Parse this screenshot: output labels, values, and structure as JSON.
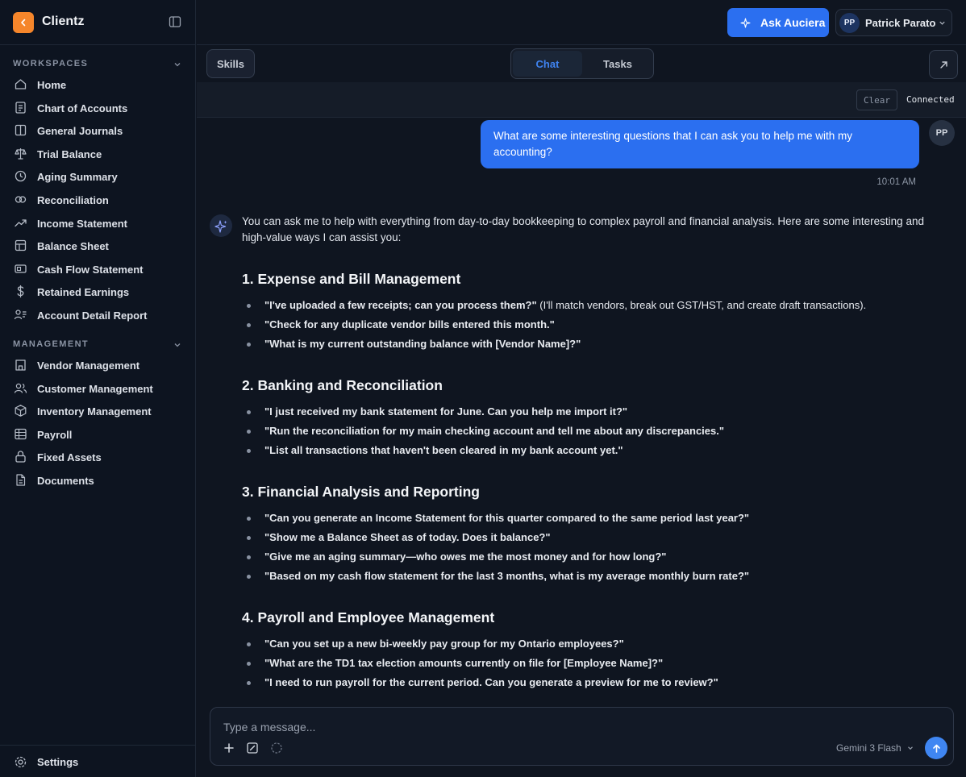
{
  "brand": {
    "name": "Clientz"
  },
  "sidebar": {
    "workspaces_label": "WORKSPACES",
    "workspaces": [
      {
        "label": "Home",
        "icon": "home-icon"
      },
      {
        "label": "Chart of Accounts",
        "icon": "document-list-icon"
      },
      {
        "label": "General Journals",
        "icon": "book-icon"
      },
      {
        "label": "Trial Balance",
        "icon": "scale-icon"
      },
      {
        "label": "Aging Summary",
        "icon": "clock-icon"
      },
      {
        "label": "Reconciliation",
        "icon": "link-circles-icon"
      },
      {
        "label": "Income Statement",
        "icon": "trend-up-icon"
      },
      {
        "label": "Balance Sheet",
        "icon": "table-icon"
      },
      {
        "label": "Cash Flow Statement",
        "icon": "banknote-icon"
      },
      {
        "label": "Retained Earnings",
        "icon": "dollar-icon"
      },
      {
        "label": "Account Detail Report",
        "icon": "user-list-icon"
      }
    ],
    "management_label": "MANAGEMENT",
    "management": [
      {
        "label": "Vendor Management",
        "icon": "store-icon"
      },
      {
        "label": "Customer Management",
        "icon": "users-icon"
      },
      {
        "label": "Inventory Management",
        "icon": "package-icon"
      },
      {
        "label": "Payroll",
        "icon": "grid-icon"
      },
      {
        "label": "Fixed Assets",
        "icon": "lock-icon"
      },
      {
        "label": "Documents",
        "icon": "file-icon"
      }
    ],
    "settings_label": "Settings"
  },
  "header": {
    "ask_label": "Ask Auciera",
    "user_initials": "PP",
    "user_name": "Patrick Parato"
  },
  "toolbar": {
    "skills_label": "Skills",
    "tabs": [
      {
        "label": "Chat"
      },
      {
        "label": "Tasks"
      }
    ],
    "clear_label": "Clear",
    "status": "Connected"
  },
  "chat": {
    "user_message": "What are some interesting questions that I can ask you to help me with my accounting?",
    "user_initials": "PP",
    "time": "10:01 AM",
    "ai_intro": "You can ask me to help with everything from day-to-day bookkeeping to complex payroll and financial analysis. Here are some interesting and high-value ways I can assist you:",
    "sections": [
      {
        "title": "1. Expense and Bill Management",
        "items": [
          {
            "q": "\"I've uploaded a few receipts; can you process them?\"",
            "note": " (I'll match vendors, break out GST/HST, and create draft transactions)."
          },
          {
            "q": "\"Check for any duplicate vendor bills entered this month.\"",
            "note": ""
          },
          {
            "q": "\"What is my current outstanding balance with [Vendor Name]?\"",
            "note": ""
          }
        ]
      },
      {
        "title": "2. Banking and Reconciliation",
        "items": [
          {
            "q": "\"I just received my bank statement for June. Can you help me import it?\"",
            "note": ""
          },
          {
            "q": "\"Run the reconciliation for my main checking account and tell me about any discrepancies.\"",
            "note": ""
          },
          {
            "q": "\"List all transactions that haven't been cleared in my bank account yet.\"",
            "note": ""
          }
        ]
      },
      {
        "title": "3. Financial Analysis and Reporting",
        "items": [
          {
            "q": "\"Can you generate an Income Statement for this quarter compared to the same period last year?\"",
            "note": ""
          },
          {
            "q": "\"Show me a Balance Sheet as of today. Does it balance?\"",
            "note": ""
          },
          {
            "q": "\"Give me an aging summary—who owes me the most money and for how long?\"",
            "note": ""
          },
          {
            "q": "\"Based on my cash flow statement for the last 3 months, what is my average monthly burn rate?\"",
            "note": ""
          }
        ]
      },
      {
        "title": "4. Payroll and Employee Management",
        "items": [
          {
            "q": "\"Can you set up a new bi-weekly pay group for my Ontario employees?\"",
            "note": ""
          },
          {
            "q": "\"What are the TD1 tax election amounts currently on file for [Employee Name]?\"",
            "note": ""
          },
          {
            "q": "\"I need to run payroll for the current period. Can you generate a preview for me to review?\"",
            "note": ""
          }
        ]
      }
    ]
  },
  "composer": {
    "placeholder": "Type a message...",
    "model": "Gemini 3 Flash"
  },
  "colors": {
    "accent": "#2b6ff0",
    "brand": "#f5862b"
  }
}
